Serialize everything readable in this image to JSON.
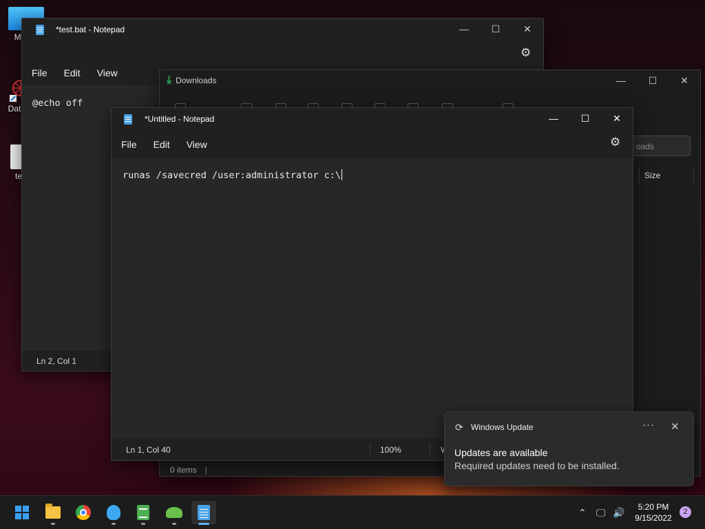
{
  "desktop": {
    "icons": [
      {
        "label": "My Co"
      },
      {
        "label": "DataW"
      },
      {
        "label": "tes"
      }
    ]
  },
  "window_test": {
    "title": "*test.bat - Notepad",
    "menu": [
      "File",
      "Edit",
      "View"
    ],
    "content": "@echo off",
    "status_position": "Ln 2, Col 1"
  },
  "window_downloads": {
    "title": "Downloads",
    "search_placeholder": "oads",
    "column_size": "Size",
    "status_items": "0 items"
  },
  "window_untitled": {
    "title": "*Untitled - Notepad",
    "menu": [
      "File",
      "Edit",
      "View"
    ],
    "content": "runas /savecred /user:administrator c:\\",
    "status_position": "Ln 1, Col 40",
    "status_zoom": "100%",
    "status_lineend": "W"
  },
  "toast": {
    "app_name": "Windows Update",
    "title": "Updates are available",
    "body": "Required updates need to be installed.",
    "more_label": "···",
    "close_label": "✕"
  },
  "taskbar": {
    "apps": [
      {
        "icon": "windows-start-icon"
      },
      {
        "icon": "file-explorer-icon"
      },
      {
        "icon": "chrome-icon"
      },
      {
        "icon": "tips-icon"
      },
      {
        "icon": "spreadsheet-icon"
      },
      {
        "icon": "turtle-app-icon"
      },
      {
        "icon": "notepad-icon"
      }
    ],
    "time": "5:20 PM",
    "date": "9/15/2022",
    "notification_count": "2"
  },
  "colors": {
    "accent": "#5fb2ff",
    "notepad_blue": "#4aa3e8",
    "download_green": "#2fb15a"
  }
}
